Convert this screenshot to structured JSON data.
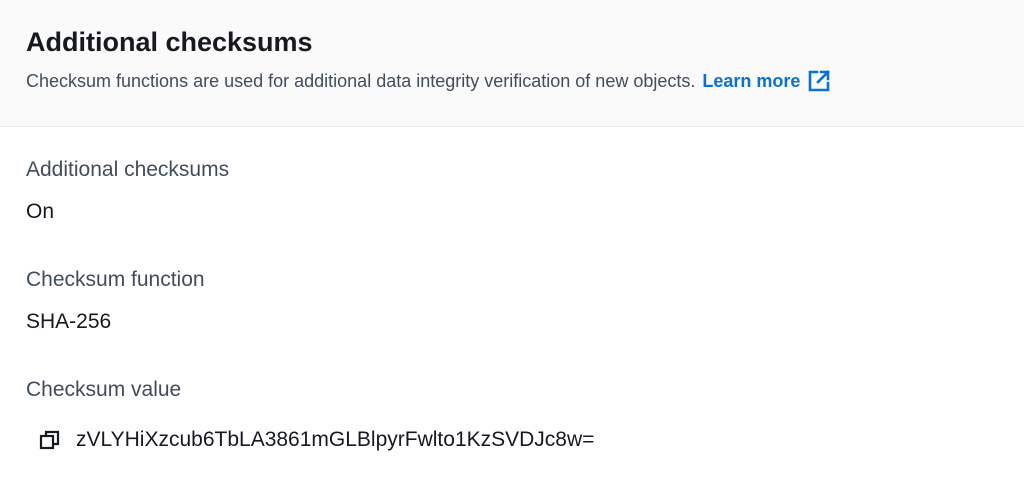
{
  "header": {
    "title": "Additional checksums",
    "description": "Checksum functions are used for additional data integrity verification of new objects.",
    "learn_more": "Learn more"
  },
  "fields": {
    "additional_checksums": {
      "label": "Additional checksums",
      "value": "On"
    },
    "checksum_function": {
      "label": "Checksum function",
      "value": "SHA-256"
    },
    "checksum_value": {
      "label": "Checksum value",
      "value": "zVLYHiXzcub6TbLA3861mGLBlpyrFwlto1KzSVDJc8w="
    }
  },
  "icons": {
    "external_link": "external-link-icon",
    "copy": "copy-icon"
  },
  "colors": {
    "link": "#0972d3",
    "label": "#414d5c",
    "text": "#16191f",
    "header_bg": "#fafafa"
  }
}
